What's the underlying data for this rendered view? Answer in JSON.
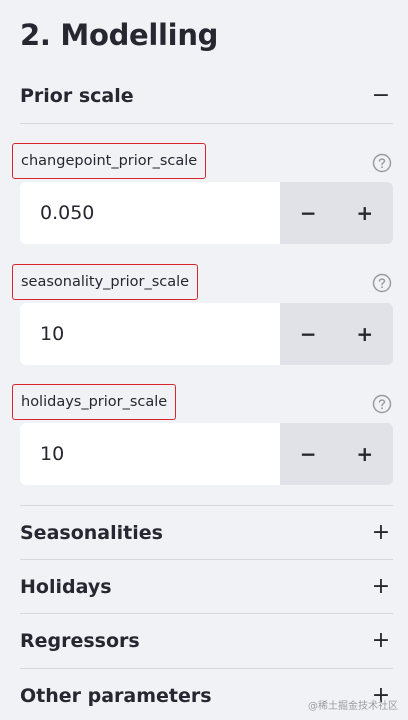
{
  "page": {
    "title": "2. Modelling"
  },
  "prior_scale": {
    "title": "Prior scale",
    "toggle": "−",
    "params": [
      {
        "label": "changepoint_prior_scale",
        "value": "0.050",
        "minus": "−",
        "plus": "+"
      },
      {
        "label": "seasonality_prior_scale",
        "value": "10",
        "minus": "−",
        "plus": "+"
      },
      {
        "label": "holidays_prior_scale",
        "value": "10",
        "minus": "−",
        "plus": "+"
      }
    ]
  },
  "sections": [
    {
      "title": "Seasonalities",
      "toggle": "+"
    },
    {
      "title": "Holidays",
      "toggle": "+"
    },
    {
      "title": "Regressors",
      "toggle": "+"
    },
    {
      "title": "Other parameters",
      "toggle": "+"
    }
  ],
  "watermark": "@稀土掘金技术社区",
  "icons": {
    "help": "question-circle-icon"
  },
  "colors": {
    "background": "#f0f2f6",
    "input_bg": "#ffffff",
    "stepper_bg": "#e0e2e8",
    "highlight_border": "#d8262f",
    "text": "#262730"
  }
}
